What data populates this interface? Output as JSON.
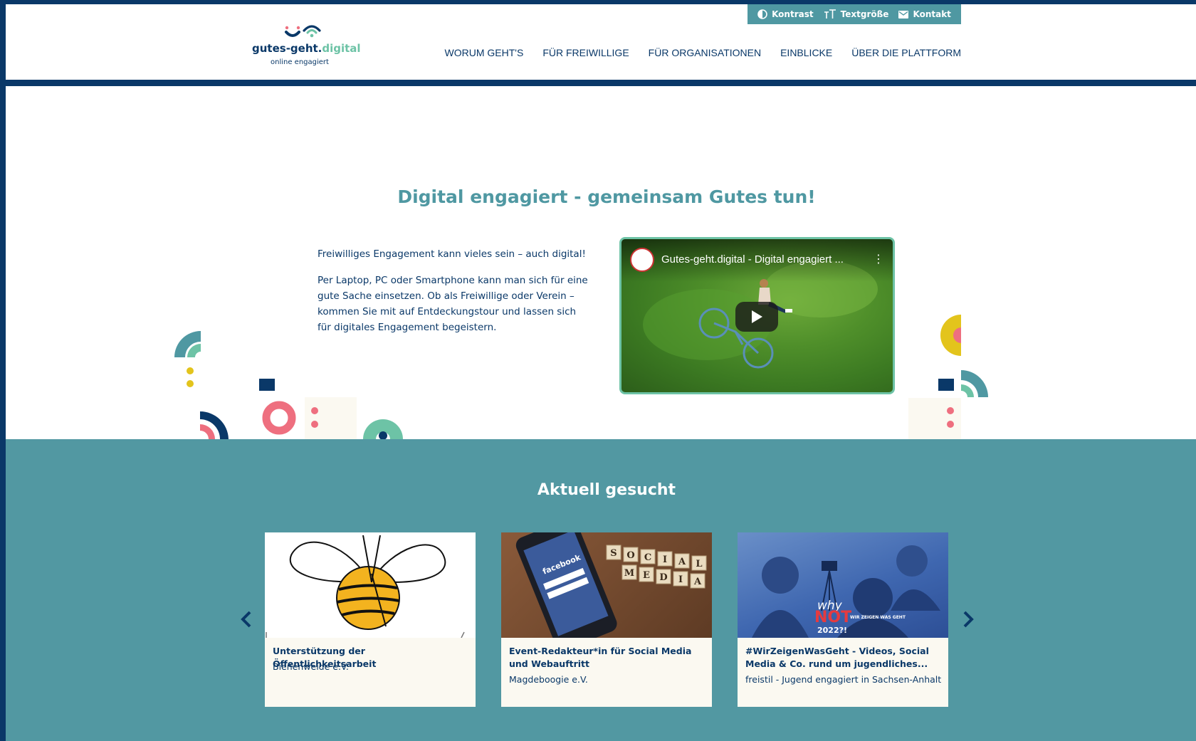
{
  "utility": {
    "contrast_label": "Kontrast",
    "textsize_label": "Textgröße",
    "contact_label": "Kontakt"
  },
  "logo": {
    "word_main": "gutes-geht.",
    "word_accent": "digital",
    "tagline": "online engagiert"
  },
  "nav": {
    "items": [
      {
        "label": "WORUM GEHT'S"
      },
      {
        "label": "FÜR FREIWILLIGE"
      },
      {
        "label": "FÜR ORGANISATIONEN"
      },
      {
        "label": "EINBLICKE"
      },
      {
        "label": "ÜBER DIE PLATTFORM"
      }
    ]
  },
  "hero": {
    "title": "Digital engagiert - gemeinsam Gutes tun!",
    "paragraph_1": "Freiwilliges Engagement kann vieles sein – auch digital!",
    "paragraph_2": "Per Laptop, PC oder Smartphone kann man sich für eine gute Sache einsetzen. Ob als Freiwillige oder Verein – kommen Sie mit auf Entdeckungstour und lassen sich für digitales Engagement begeistern."
  },
  "video": {
    "title": "Gutes-geht.digital - Digital engagiert ..."
  },
  "current": {
    "title": "Aktuell gesucht",
    "cards": [
      {
        "title": "Unterstützung der Öffentlichkeitsarbeit",
        "org": "Bienenweide e.V."
      },
      {
        "title": "Event-Redakteur*in für Social Media und Webauftritt",
        "org": "Magdeboogie e.V."
      },
      {
        "title": "#WirZeigenWasGeht - Videos, Social Media & Co. rund um jugendliches...",
        "org": "freistil - Jugend engagiert in Sachsen-Anhalt"
      }
    ]
  },
  "images": {
    "social_tiles": [
      "S",
      "O",
      "C",
      "I",
      "A",
      "L",
      "M",
      "E",
      "D",
      "I",
      "A"
    ],
    "phone_brand": "facebook",
    "poster_why": "why",
    "poster_not": "NOT",
    "poster_side": "WIR ZEIGEN WAS GEHT",
    "poster_year": "2022?!"
  },
  "colors": {
    "navy": "#0a3868",
    "teal": "#5298a2",
    "mint": "#6dc3a6",
    "pink": "#ee6f7f",
    "yellow": "#e3c41c",
    "cream": "#fbf9f1"
  }
}
